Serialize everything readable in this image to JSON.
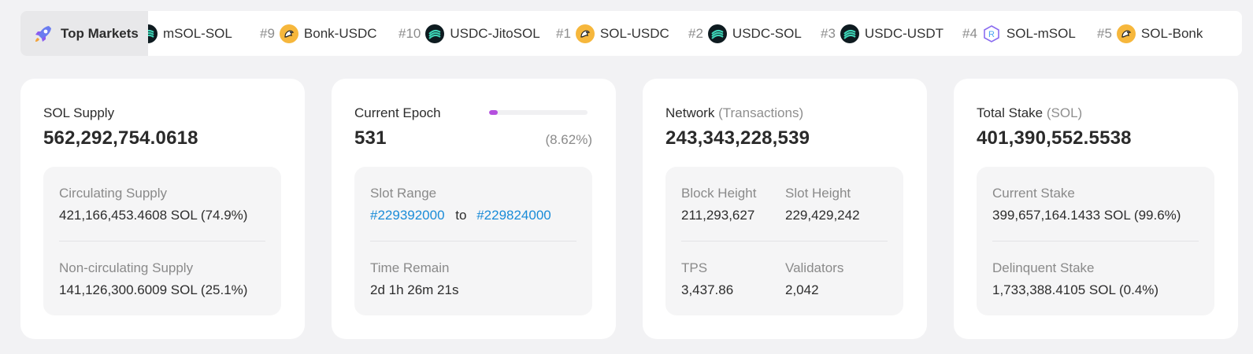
{
  "top_markets": {
    "label": "Top Markets",
    "items": [
      {
        "rank": "",
        "pair": "mSOL-SOL",
        "icon": "jito-sol-token-icon"
      },
      {
        "rank": "#9",
        "pair": "Bonk-USDC",
        "icon": "bonk-token-icon"
      },
      {
        "rank": "#10",
        "pair": "USDC-JitoSOL",
        "icon": "jito-sol-token-icon"
      },
      {
        "rank": "#1",
        "pair": "SOL-USDC",
        "icon": "bonk-token-icon"
      },
      {
        "rank": "#2",
        "pair": "USDC-SOL",
        "icon": "jito-sol-token-icon"
      },
      {
        "rank": "#3",
        "pair": "USDC-USDT",
        "icon": "jito-sol-token-icon"
      },
      {
        "rank": "#4",
        "pair": "SOL-mSOL",
        "icon": "raydium-token-icon"
      },
      {
        "rank": "#5",
        "pair": "SOL-Bonk",
        "icon": "bonk-token-icon"
      }
    ]
  },
  "supply": {
    "title": "SOL Supply",
    "value": "562,292,754.0618",
    "circulating_label": "Circulating Supply",
    "circulating_value": "421,166,453.4608 SOL (74.9%)",
    "noncirculating_label": "Non-circulating Supply",
    "noncirculating_value": "141,126,300.6009 SOL (25.1%)"
  },
  "epoch": {
    "title": "Current Epoch",
    "value": "531",
    "progress_percent": 8.62,
    "progress_text": "(8.62%)",
    "slot_range_label": "Slot Range",
    "slot_start": "#229392000",
    "slot_to": "to",
    "slot_end": "#229824000",
    "time_remain_label": "Time Remain",
    "time_remain_value": "2d 1h 26m 21s"
  },
  "network": {
    "title": "Network",
    "title_sub": "(Transactions)",
    "value": "243,343,228,539",
    "block_height_label": "Block Height",
    "block_height_value": "211,293,627",
    "slot_height_label": "Slot Height",
    "slot_height_value": "229,429,242",
    "tps_label": "TPS",
    "tps_value": "3,437.86",
    "validators_label": "Validators",
    "validators_value": "2,042"
  },
  "stake": {
    "title": "Total Stake",
    "title_sub": "(SOL)",
    "value": "401,390,552.5538",
    "current_label": "Current Stake",
    "current_value": "399,657,164.1433 SOL (99.6%)",
    "delinquent_label": "Delinquent Stake",
    "delinquent_value": "1,733,388.4105 SOL (0.4%)"
  },
  "colors": {
    "accent_link": "#1a8cd8",
    "progress_fill": "#b44fde",
    "page_background": "#f2f2f4"
  }
}
